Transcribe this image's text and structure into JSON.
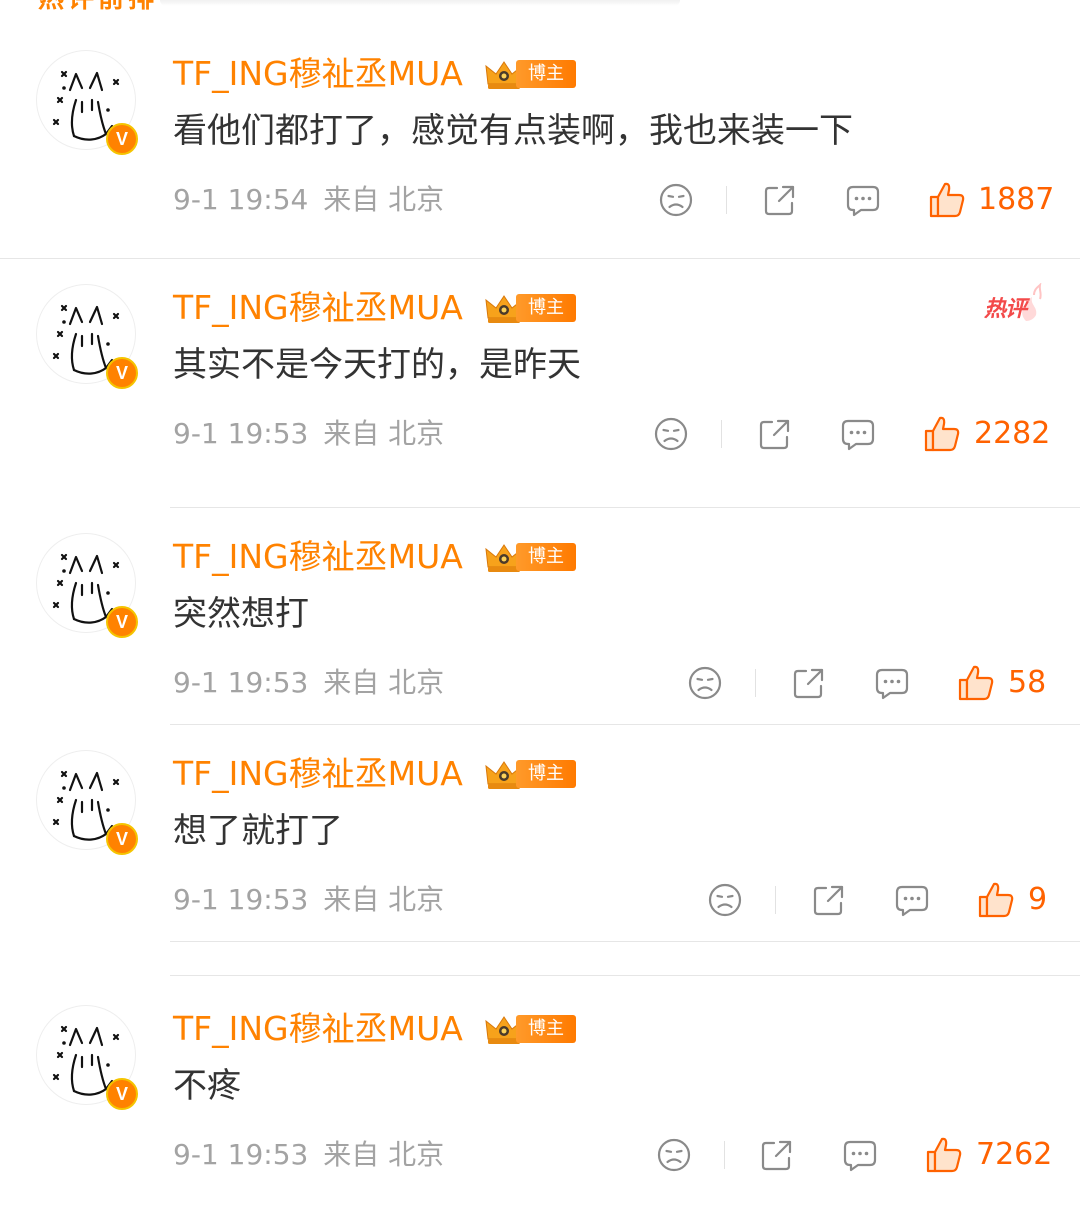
{
  "top_fragment": "热评前排",
  "comments": [
    {
      "username": "TF_ING穆祉丞MUA",
      "badge": "博主",
      "text": "看他们都打了，感觉有点装啊，我也来装一下",
      "time": "9-1 19:54",
      "location": "来自 北京",
      "likes": "1887",
      "hot_tag": ""
    },
    {
      "username": "TF_ING穆祉丞MUA",
      "badge": "博主",
      "text": "其实不是今天打的，是昨天",
      "time": "9-1 19:53",
      "location": "来自 北京",
      "likes": "2282",
      "hot_tag": "热评"
    },
    {
      "username": "TF_ING穆祉丞MUA",
      "badge": "博主",
      "text": "突然想打",
      "time": "9-1 19:53",
      "location": "来自 北京",
      "likes": "58",
      "hot_tag": ""
    },
    {
      "username": "TF_ING穆祉丞MUA",
      "badge": "博主",
      "text": "想了就打了",
      "time": "9-1 19:53",
      "location": "来自 北京",
      "likes": "9",
      "hot_tag": ""
    },
    {
      "username": "TF_ING穆祉丞MUA",
      "badge": "博主",
      "text": "不疼",
      "time": "9-1 19:53",
      "location": "来自 北京",
      "likes": "7262",
      "hot_tag": ""
    }
  ],
  "verified_mark": "V",
  "icons": {
    "dislike": "sad-face-icon",
    "share": "share-icon",
    "reply": "comment-bubble-icon",
    "like": "thumbs-up-icon",
    "crown": "crown-badge-icon",
    "verified": "verified-badge-icon"
  },
  "colors": {
    "accent": "#ff8200",
    "like": "#ff6200",
    "hot": "#f34a4a",
    "text": "#333333",
    "meta": "#a3a3a3"
  }
}
